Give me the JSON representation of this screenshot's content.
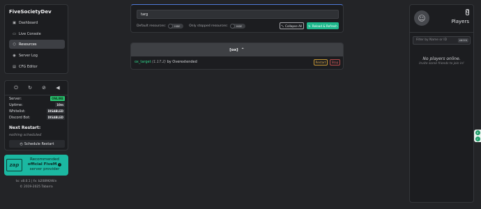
{
  "sidebar": {
    "brand": "FiveSocietyDev",
    "items": [
      {
        "label": "Dashboard",
        "icon": "dashboard-icon"
      },
      {
        "label": "Live Console",
        "icon": "terminal-icon"
      },
      {
        "label": "Resources",
        "icon": "box-icon",
        "active": true
      },
      {
        "label": "Server Log",
        "icon": "eye-icon"
      },
      {
        "label": "CFG Editor",
        "icon": "file-edit-icon"
      }
    ]
  },
  "status": {
    "controls": [
      "power-icon",
      "restart-icon",
      "lock-off-icon",
      "megaphone-icon"
    ],
    "server_label": "Server:",
    "server_value": "ONLINE",
    "uptime_label": "Uptime:",
    "uptime_value": "10m",
    "whitelist_label": "Whitelist:",
    "whitelist_value": "DISABLED",
    "discord_label": "Discord Bot:",
    "discord_value": "DISABLED",
    "next_restart_title": "Next Restart:",
    "next_restart_value": "nothing scheduled",
    "schedule_button": "Schedule Restart"
  },
  "promo": {
    "logo": "zap",
    "line1": "Recommended",
    "line2_bold": "official FiveM",
    "line3": "server provider"
  },
  "footer": {
    "version": "tx: v8.0.1 | fx: b20896/Win",
    "copyright": "© 2019-2025 Tabarra"
  },
  "search": {
    "value": "targ",
    "default_resources_label": "Default resources:",
    "default_resources_toggle": "HIDE",
    "stopped_resources_label": "Only stopped resources:",
    "stopped_resources_toggle": "HIDE",
    "collapse_button": "Collapse All",
    "reload_button": "Reload & Refresh"
  },
  "resources": {
    "group_title": "[ox]",
    "items": [
      {
        "name": "ox_target",
        "version": "(1.17.2)",
        "author": "by Overextended",
        "restart": "Restart",
        "stop": "Stop"
      }
    ]
  },
  "players": {
    "count": "0",
    "label": "Players",
    "filter_placeholder": "Filter by Name or ID",
    "filter_shortcut": "ctrl+k",
    "empty_title": "No players online.",
    "empty_subtitle": "Invite some friends to join in!"
  },
  "colors": {
    "background": "#232427",
    "card": "#1c1d20",
    "online": "#29c46f",
    "accent_green": "#1fb98d",
    "promo": "#1bb8a1"
  }
}
